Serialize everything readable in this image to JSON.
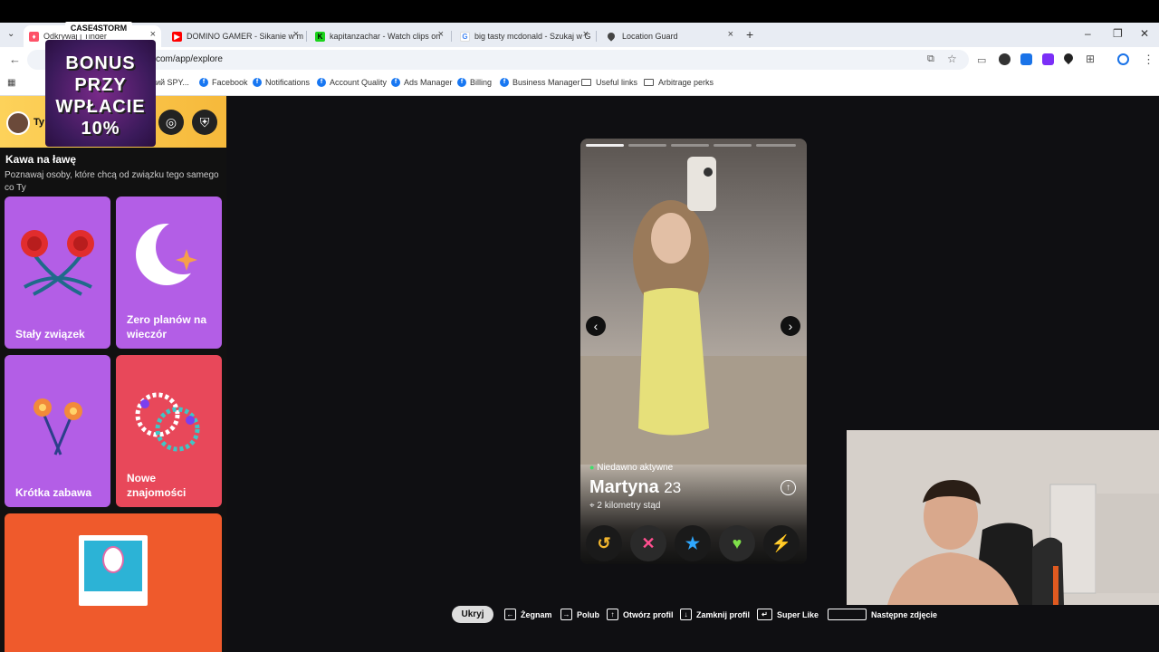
{
  "browser": {
    "tabs": [
      {
        "title": "Odkrywaj | Tinder",
        "active": true
      },
      {
        "title": "DOMINO GAMER - Sikanie w m"
      },
      {
        "title": "kapitanzachar - Watch clips on"
      },
      {
        "title": "big tasty mcdonald - Szukaj w G"
      },
      {
        "title": "Location Guard"
      }
    ],
    "new_tab": "+",
    "url": "com/app/explore",
    "bookmarks": [
      {
        "label": "ий SPY..."
      },
      {
        "label": "Facebook"
      },
      {
        "label": "Notifications"
      },
      {
        "label": "Account Quality"
      },
      {
        "label": "Ads Manager"
      },
      {
        "label": "Billing"
      },
      {
        "label": "Business Manager"
      },
      {
        "label": "Useful links"
      },
      {
        "label": "Arbitrage perks"
      }
    ]
  },
  "overlay": {
    "logo": "CASE4STORM",
    "promo_lines": [
      "BONUS",
      "PRZY",
      "WPŁACIE",
      "10%"
    ]
  },
  "sidebar": {
    "user": "Ty",
    "section_title": "Kawa na ławę",
    "section_subtitle": "Poznawaj osoby, które chcą od związku tego samego co Ty",
    "cards": [
      {
        "label": "Stały związek",
        "color": "#b35ee6"
      },
      {
        "label": "Zero planów na wieczór",
        "color": "#b35ee6"
      },
      {
        "label": "Krótka zabawa",
        "color": "#b35ee6"
      },
      {
        "label": "Nowe znajomości",
        "color": "#e8485a"
      }
    ],
    "bottom_card_color": "#ef5a2c"
  },
  "profile": {
    "status": "Niedawno aktywne",
    "name": "Martyna",
    "age": "23",
    "distance": "2 kilometry stąd",
    "photo_count": 5,
    "current_photo": 1
  },
  "actions": [
    {
      "name": "rewind",
      "glyph": "↺",
      "color": "#f5b82e"
    },
    {
      "name": "nope",
      "glyph": "✕",
      "color": "#ff4f8f"
    },
    {
      "name": "super-like",
      "glyph": "★",
      "color": "#2fa8ff"
    },
    {
      "name": "like",
      "glyph": "♥",
      "color": "#7fe04a"
    },
    {
      "name": "boost",
      "glyph": "⚡",
      "color": "#a25cf0"
    }
  ],
  "shortcuts": {
    "hide": "Ukryj",
    "items": [
      {
        "key": "←",
        "label": "Żegnam"
      },
      {
        "key": "→",
        "label": "Polub"
      },
      {
        "key": "↑",
        "label": "Otwórz profil"
      },
      {
        "key": "↓",
        "label": "Zamknij profil"
      },
      {
        "key": "↵",
        "label": "Super Like"
      },
      {
        "key": "",
        "label": "Następne zdjęcie"
      }
    ]
  }
}
